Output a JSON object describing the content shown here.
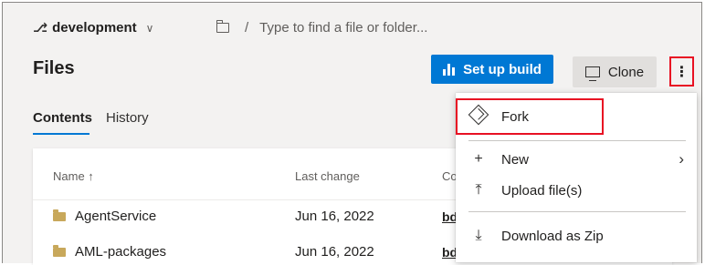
{
  "breadcrumb": {
    "branch_icon": "branch-icon",
    "branch": "development",
    "separator": "/",
    "search_placeholder": "Type to find a file or folder..."
  },
  "page": {
    "title": "Files"
  },
  "toolbar": {
    "setup_build_label": "Set up build",
    "clone_label": "Clone",
    "more_label": "⋮"
  },
  "tabs": [
    {
      "label": "Contents",
      "selected": true
    },
    {
      "label": "History",
      "selected": false
    }
  ],
  "table": {
    "columns": [
      "Name ↑",
      "Last change",
      "Co"
    ],
    "rows": [
      {
        "name": "AgentService",
        "last_change": "Jun 16, 2022",
        "commit": "bd"
      },
      {
        "name": "AML-packages",
        "last_change": "Jun 16, 2022",
        "commit": "bd"
      }
    ]
  },
  "menu": {
    "items": [
      {
        "label": "Fork",
        "icon": "fork-icon"
      },
      {
        "label": "New",
        "icon": "plus-icon",
        "submenu": true
      },
      {
        "label": "Upload file(s)",
        "icon": "upload-icon"
      },
      {
        "label": "Download as Zip",
        "icon": "download-icon"
      }
    ]
  },
  "colors": {
    "accent": "#0078d4",
    "highlight": "#e81123",
    "background": "#f3f2f1"
  }
}
